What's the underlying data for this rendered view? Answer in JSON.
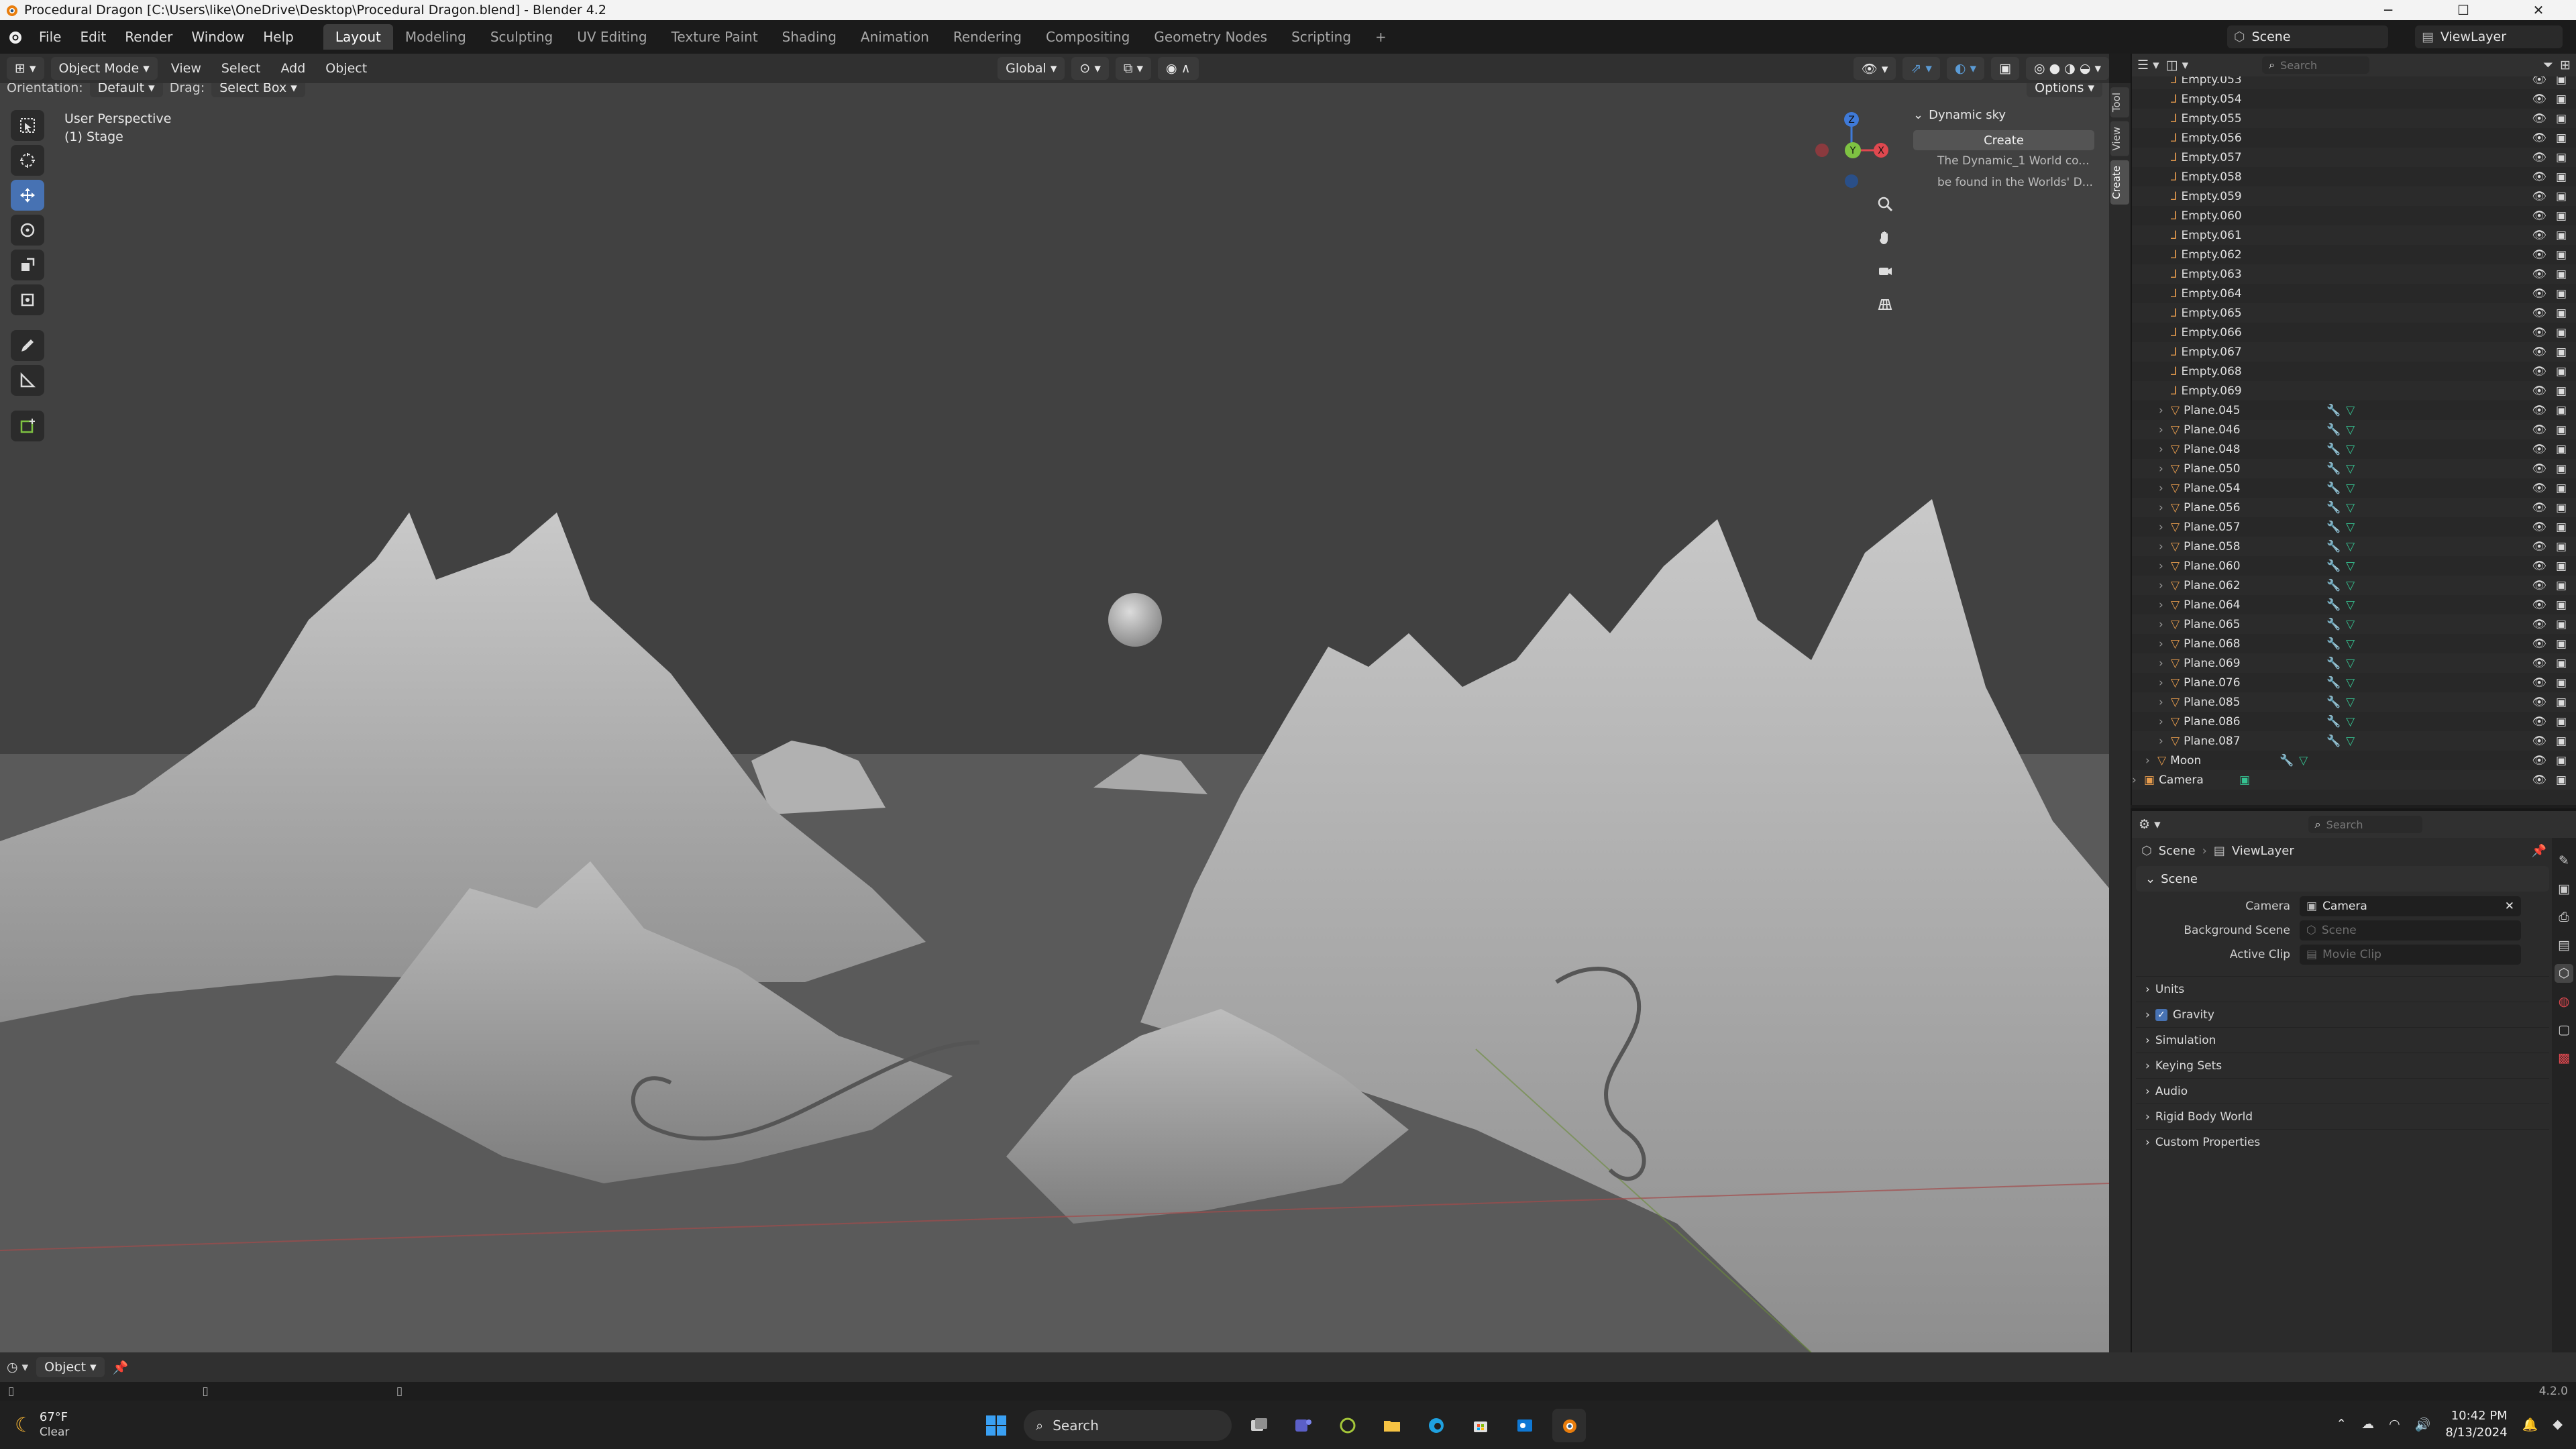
{
  "window": {
    "title": "Procedural Dragon [C:\\Users\\like\\OneDrive\\Desktop\\Procedural Dragon.blend] - Blender 4.2",
    "minimize": "─",
    "maximize": "☐",
    "close": "✕"
  },
  "menu": [
    "File",
    "Edit",
    "Render",
    "Window",
    "Help"
  ],
  "workspaces": [
    "Layout",
    "Modeling",
    "Sculpting",
    "UV Editing",
    "Texture Paint",
    "Shading",
    "Animation",
    "Rendering",
    "Compositing",
    "Geometry Nodes",
    "Scripting"
  ],
  "active_workspace": "Layout",
  "scene_selector": "Scene",
  "viewlayer_selector": "ViewLayer",
  "viewport_header": {
    "mode": "Object Mode",
    "menus": [
      "View",
      "Select",
      "Add",
      "Object"
    ],
    "transform": "Global",
    "orientation_label": "Orientation:",
    "orientation_value": "Default",
    "drag_label": "Drag:",
    "drag_value": "Select Box",
    "options": "Options"
  },
  "viewport_info": {
    "line1": "User Perspective",
    "line2": "(1) Stage"
  },
  "gizmo": {
    "z": "Z",
    "y": "Y",
    "x": "X"
  },
  "sky_panel": {
    "title": "Dynamic sky",
    "button": "Create",
    "line1": "The Dynamic_1 World co...",
    "line2": "be found in the Worlds' D..."
  },
  "side_tabs": [
    "Tool",
    "View",
    "Create"
  ],
  "outliner": {
    "search_placeholder": "Search",
    "empties": [
      "Empty.053",
      "Empty.054",
      "Empty.055",
      "Empty.056",
      "Empty.057",
      "Empty.058",
      "Empty.059",
      "Empty.060",
      "Empty.061",
      "Empty.062",
      "Empty.063",
      "Empty.064",
      "Empty.065",
      "Empty.066",
      "Empty.067",
      "Empty.068",
      "Empty.069"
    ],
    "planes": [
      "Plane.045",
      "Plane.046",
      "Plane.048",
      "Plane.050",
      "Plane.054",
      "Plane.056",
      "Plane.057",
      "Plane.058",
      "Plane.060",
      "Plane.062",
      "Plane.064",
      "Plane.065",
      "Plane.068",
      "Plane.069",
      "Plane.076",
      "Plane.085",
      "Plane.086",
      "Plane.087"
    ],
    "moon": "Moon",
    "camera": "Camera"
  },
  "properties": {
    "search_placeholder": "Search",
    "breadcrumb_scene": "Scene",
    "breadcrumb_viewlayer": "ViewLayer",
    "section": "Scene",
    "camera_label": "Camera",
    "camera_value": "Camera",
    "bg_scene_label": "Background Scene",
    "bg_scene_placeholder": "Scene",
    "active_clip_label": "Active Clip",
    "active_clip_placeholder": "Movie Clip",
    "panels": [
      "Units",
      "Gravity",
      "Simulation",
      "Keying Sets",
      "Audio",
      "Rigid Body World",
      "Custom Properties"
    ]
  },
  "timeline": {
    "mode": "Object"
  },
  "status": {
    "version": "4.2.0"
  },
  "taskbar": {
    "temp": "67°F",
    "condition": "Clear",
    "search": "Search",
    "time": "10:42 PM",
    "date": "8/13/2024"
  },
  "colors": {
    "accent": "#4772b3",
    "x_axis": "#e0484f",
    "y_axis": "#7ec242",
    "z_axis": "#3f7ad8",
    "empty_icon": "#e59b4d",
    "mesh_icon": "#e59b4d",
    "modifier_icon": "#5b9bd5",
    "data_icon": "#35c291"
  }
}
